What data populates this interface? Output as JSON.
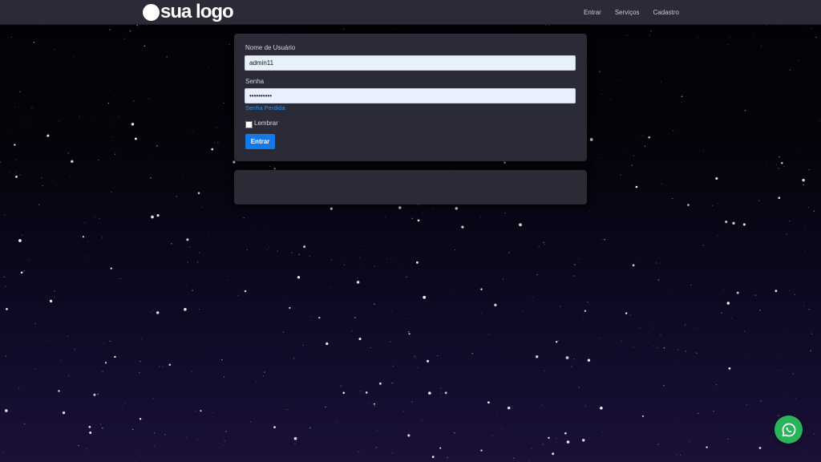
{
  "brand": {
    "logo_text": "sua logo"
  },
  "nav": {
    "items": [
      "Entrar",
      "Serviços",
      "Cadastro"
    ]
  },
  "login_form": {
    "username_label": "Nome de Usuário",
    "username_value": "admin11",
    "password_label": "Senha",
    "password_value": "••••••••••",
    "lost_password_link": "Senha Perdida",
    "remember_label": "Lembrar",
    "remember_checked": false,
    "submit_label": "Entrar"
  },
  "floating": {
    "icon": "whatsapp-icon"
  },
  "colors": {
    "topbar": "#2b2b38",
    "card": "#2b2b37",
    "accent_button": "#1479e6",
    "link": "#3f8fde",
    "whatsapp": "#29b45b",
    "input_bg": "#e8f0fe"
  }
}
